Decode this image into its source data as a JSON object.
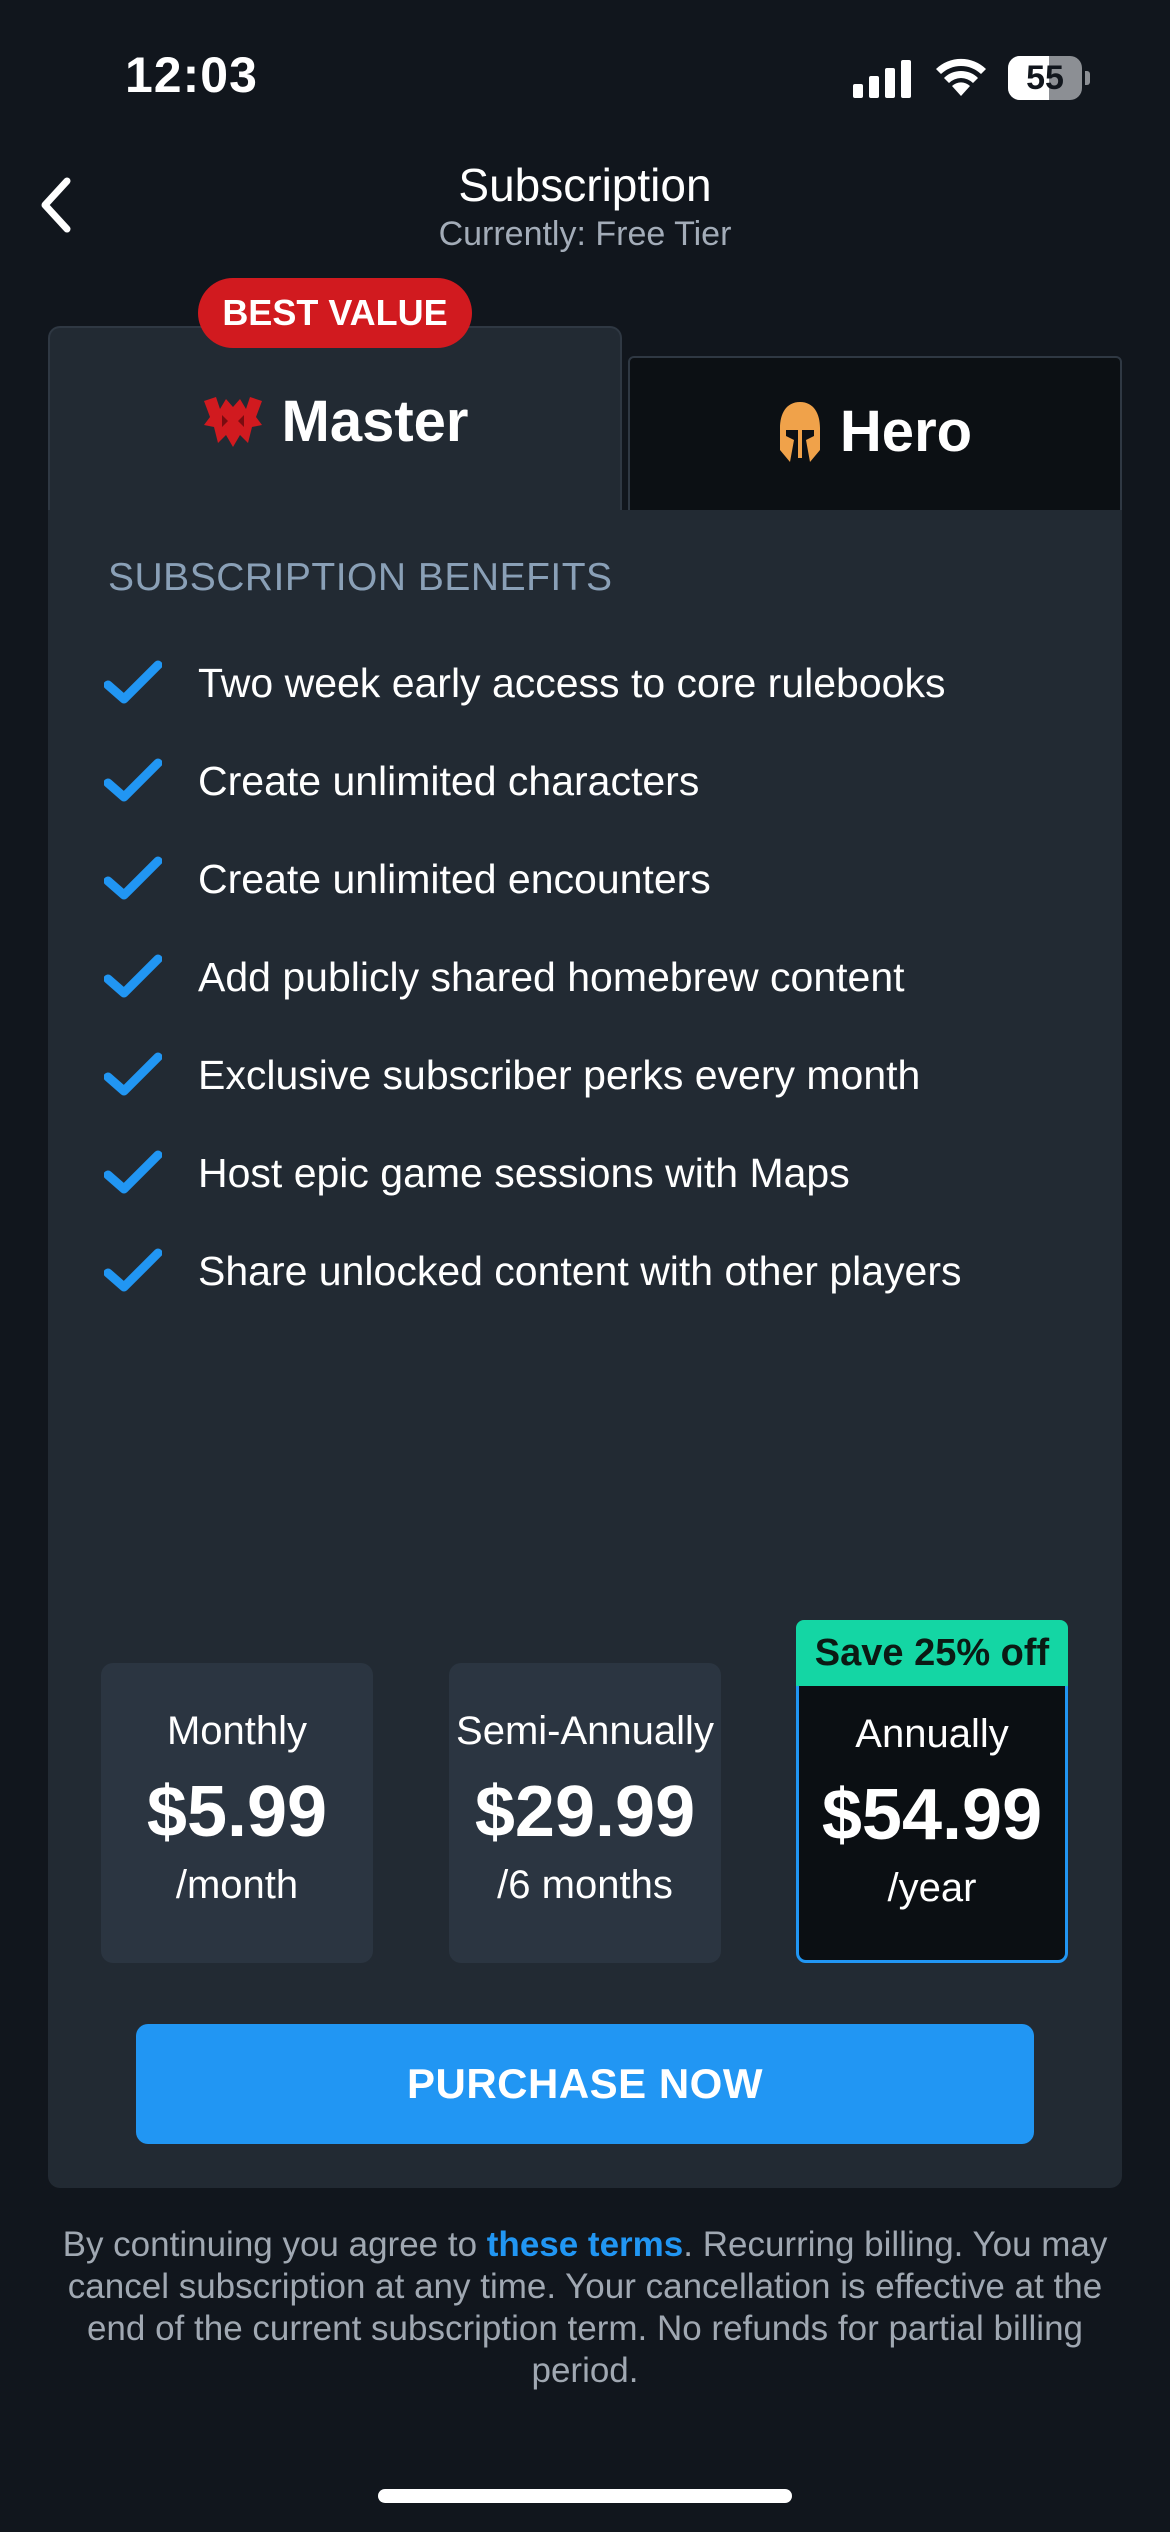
{
  "status_bar": {
    "time": "12:03",
    "battery_level": "55",
    "battery_fraction": 0.55,
    "icons": [
      "cellular-signal-icon",
      "wifi-icon",
      "battery-icon"
    ]
  },
  "header": {
    "back_icon": "chevron-left-icon",
    "title": "Subscription",
    "subtitle": "Currently: Free Tier"
  },
  "tabs": [
    {
      "label": "Master",
      "icon": "master-emblem-icon",
      "selected": true,
      "badge": "BEST VALUE"
    },
    {
      "label": "Hero",
      "icon": "helmet-icon",
      "selected": false
    }
  ],
  "benefits": {
    "heading": "SUBSCRIPTION BENEFITS",
    "items": [
      "Two week early access to core rulebooks",
      "Create unlimited characters",
      "Create unlimited encounters",
      "Add publicly shared homebrew content",
      "Exclusive subscriber perks every month",
      "Host epic game sessions with Maps",
      "Share unlocked content with other players"
    ]
  },
  "plans": [
    {
      "name": "Monthly",
      "price": "$5.99",
      "period": "/month",
      "selected": false
    },
    {
      "name": "Semi-Annually",
      "price": "$29.99",
      "period": "/6 months",
      "selected": false
    },
    {
      "name": "Annually",
      "price": "$54.99",
      "period": "/year",
      "selected": true,
      "badge": "Save 25% off"
    }
  ],
  "purchase_label": "PURCHASE NOW",
  "terms": {
    "prefix": "By continuing you agree to ",
    "link": "these terms",
    "suffix": ". Recurring billing. You may cancel subscription at any time. Your cancellation is effective at the end of the current subscription term. No refunds for partial billing period."
  },
  "colors": {
    "background": "#11161d",
    "panel": "#222a33",
    "accent": "#2196f3",
    "badge_red": "#d11a1f",
    "save_green": "#14d6a4",
    "hero_orange": "#f0a24a"
  }
}
